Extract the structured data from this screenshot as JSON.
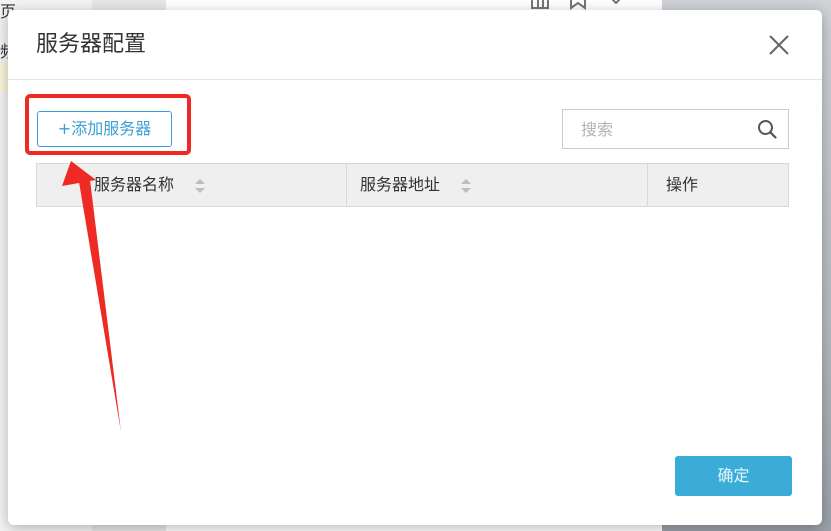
{
  "background": {
    "left_text": [
      "页",
      "频"
    ]
  },
  "dialog": {
    "title": "服务器配置",
    "add_button_label": "+添加服务器",
    "search": {
      "placeholder": "搜索",
      "value": ""
    },
    "table": {
      "columns": [
        "服务器名称",
        "服务器地址",
        "操作"
      ],
      "rows": []
    },
    "confirm_button_label": "确定"
  },
  "annotation": {
    "color": "#ee2a24"
  },
  "colors": {
    "accent": "#3a9fd5",
    "confirm_button": "#3aacd7",
    "table_header_bg": "#efefef"
  }
}
